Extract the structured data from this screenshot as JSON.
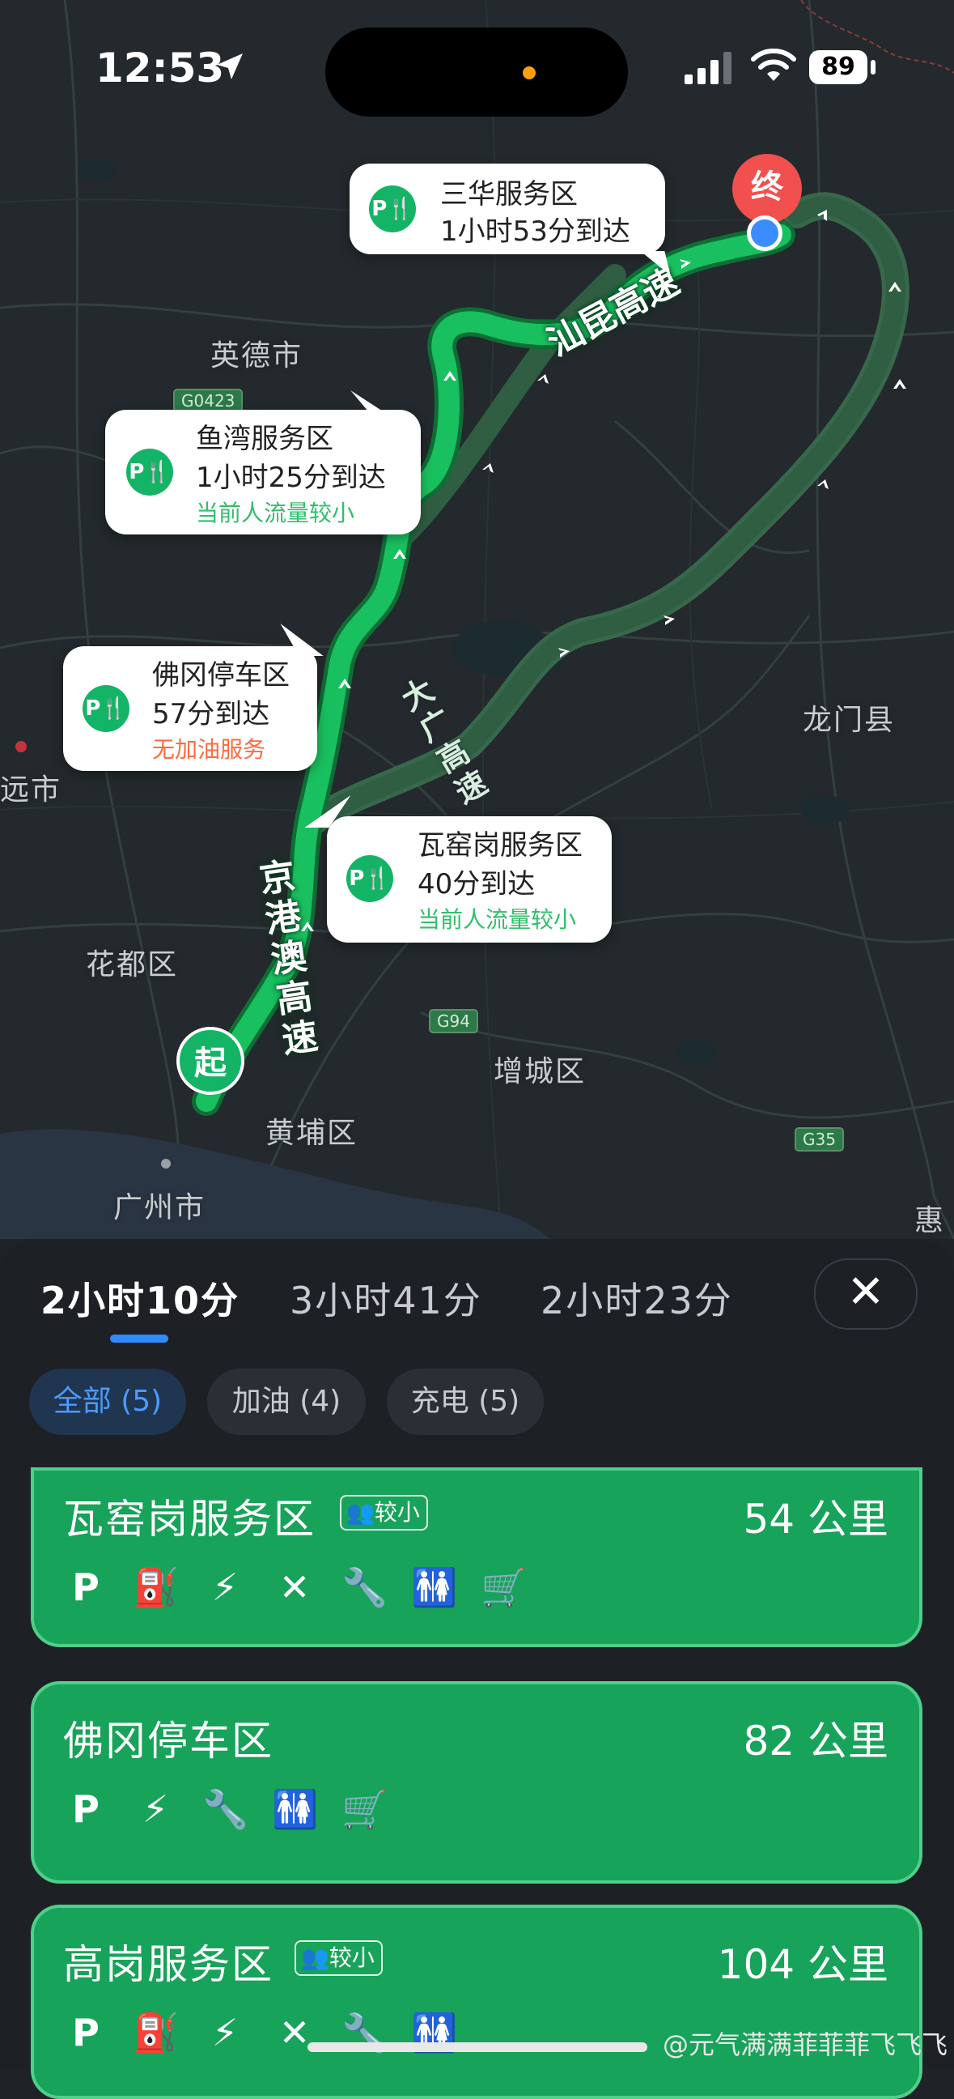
{
  "status_bar": {
    "time": "12:53",
    "battery": "89"
  },
  "map": {
    "labels": {
      "yingde": "英德市",
      "longmen": "龙门县",
      "qingyuan": "远市",
      "huadu": "花都区",
      "zengcheng": "增城区",
      "huangpu": "黄埔区",
      "guangzhou": "广州市",
      "hui": "惠"
    },
    "road_signs": {
      "g0423": "G0423",
      "g94": "G94",
      "g35": "G35"
    },
    "highways": {
      "shanmin": "汕昆高速",
      "jinggangao": "京港澳高速",
      "daguang": "大广高速"
    },
    "markers": {
      "start": "起",
      "end": "终"
    },
    "callouts": [
      {
        "name": "三华服务区",
        "eta": "1小时53分到达",
        "note": "",
        "icon": "service-area-icon"
      },
      {
        "name": "鱼湾服务区",
        "eta": "1小时25分到达",
        "note": "当前人流量较小",
        "note_color": "#2fbf6a",
        "icon": "service-area-icon"
      },
      {
        "name": "佛冈停车区",
        "eta": "57分到达",
        "note": "无加油服务",
        "note_color": "#ff6a3d",
        "icon": "service-area-icon"
      },
      {
        "name": "瓦窑岗服务区",
        "eta": "40分到达",
        "note": "当前人流量较小",
        "note_color": "#2fbf6a",
        "icon": "service-area-icon"
      }
    ]
  },
  "sheet": {
    "routes": [
      {
        "label": "2小时10分",
        "active": true
      },
      {
        "label": "3小时41分",
        "active": false
      },
      {
        "label": "2小时23分",
        "active": false
      }
    ],
    "close_label": "✕",
    "filters": [
      {
        "label": "全部 (5)",
        "active": true
      },
      {
        "label": "加油 (4)",
        "active": false
      },
      {
        "label": "充电 (5)",
        "active": false
      }
    ],
    "stations": [
      {
        "name": "瓦窑岗服务区",
        "badge": "较小",
        "distance": "54 公里",
        "facilities": [
          "parking-cafe-icon",
          "fuel-icon",
          "ev-charging-icon",
          "restaurant-icon",
          "repair-icon",
          "restroom-icon",
          "shop-cart-icon"
        ]
      },
      {
        "name": "佛冈停车区",
        "badge": "",
        "distance": "82 公里",
        "facilities": [
          "parking-cafe-icon",
          "ev-charging-icon",
          "repair-icon",
          "restroom-icon",
          "shop-cart-icon"
        ]
      },
      {
        "name": "高岗服务区",
        "badge": "较小",
        "distance": "104 公里",
        "facilities": [
          "parking-cafe-icon",
          "fuel-icon",
          "ev-charging-icon",
          "restaurant-icon",
          "repair-icon",
          "restroom-icon"
        ]
      }
    ]
  },
  "watermark": "@元气满满菲菲菲飞飞飞",
  "colors": {
    "route_active": "#19c05f",
    "route_alt": "#2f5e43",
    "accent_blue": "#2f8bff",
    "card_green": "#17a35a"
  }
}
